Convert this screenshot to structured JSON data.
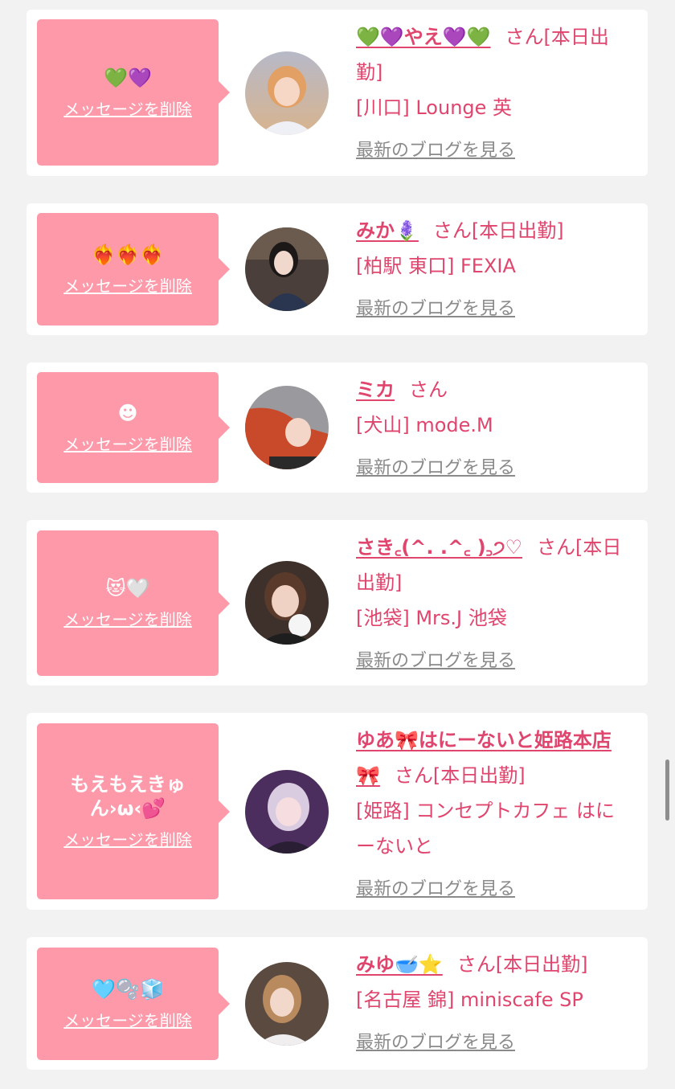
{
  "cards": [
    {
      "message": "💚💜",
      "delete_label": "メッセージを削除",
      "name": "💚💜やえ💜💚",
      "suffix": "さん[本日出勤]",
      "shop": "[川口] Lounge 英",
      "blog_label": "最新のブログを見る"
    },
    {
      "message": "❤️‍🔥❤️‍🔥❤️‍🔥",
      "delete_label": "メッセージを削除",
      "name": "みか🪻",
      "suffix": "さん[本日出勤]",
      "shop": "[柏駅 東口] FEXIA",
      "blog_label": "最新のブログを見る"
    },
    {
      "message": "☻",
      "delete_label": "メッセージを削除",
      "name": "ミカ",
      "suffix": "さん",
      "shop": "[犬山] mode.M",
      "blog_label": "最新のブログを見る"
    },
    {
      "message": "😻🤍",
      "delete_label": "メッセージを削除",
      "name": "さき꜀(^. .^꜀ )꜆੭♡",
      "suffix": "さん[本日出勤]",
      "shop": "[池袋] Mrs.J 池袋",
      "blog_label": "最新のブログを見る"
    },
    {
      "message": "もえもえきゅん›ω‹💕",
      "delete_label": "メッセージを削除",
      "name": "ゆあ🎀はにーないと姫路本店🎀",
      "suffix": "さん[本日出勤]",
      "shop": "[姫路] コンセプトカフェ はにーないと",
      "blog_label": "最新のブログを見る"
    },
    {
      "message": "🩵🫧🧊",
      "delete_label": "メッセージを削除",
      "name": "みゆ🥣⭐️",
      "suffix": "さん[本日出勤]",
      "shop": "[名古屋 錦] miniscafe SP",
      "blog_label": "最新のブログを見る"
    }
  ],
  "avatar_colors": [
    "#c9a98a",
    "#3b3434",
    "#c94a2a",
    "#4a3a34",
    "#5a3f6e",
    "#7a5a48"
  ]
}
